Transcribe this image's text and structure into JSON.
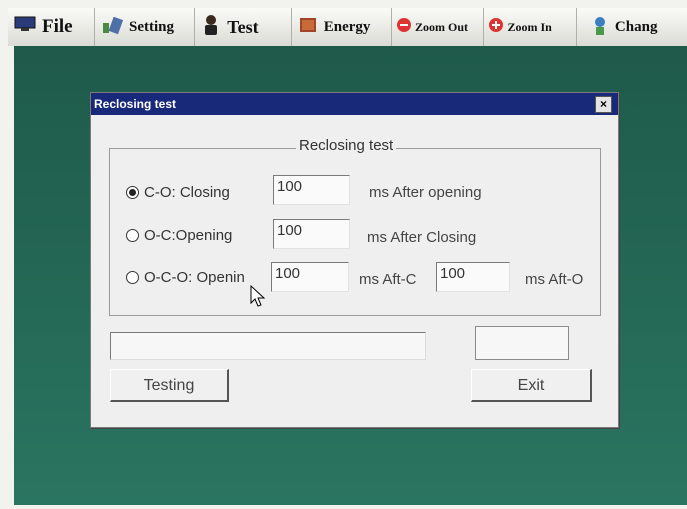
{
  "menubar": {
    "items": [
      {
        "label": "File",
        "icon": "monitor-icon"
      },
      {
        "label": "Setting",
        "icon": "setting-icon"
      },
      {
        "label": "Test",
        "icon": "person-icon"
      },
      {
        "label": "Energy",
        "icon": "book-icon"
      },
      {
        "label": "Zoom Out",
        "icon": "minus-circle-icon"
      },
      {
        "label": "Zoom In",
        "icon": "plus-circle-icon"
      },
      {
        "label": "Chang",
        "icon": "change-icon"
      }
    ]
  },
  "dialog": {
    "title": "Reclosing test",
    "close": "×",
    "group_label": "Reclosing test",
    "options": [
      {
        "label": "C-O: Closing",
        "checked": true,
        "value": "100",
        "unit": "ms After opening"
      },
      {
        "label": "O-C:Opening",
        "checked": false,
        "value": "100",
        "unit": "ms After Closing"
      },
      {
        "label": "O-C-O: Openin",
        "checked": false,
        "value": "100",
        "unit": "ms Aft-C",
        "value2": "100",
        "unit2": "ms Aft-O"
      }
    ],
    "progress_value": "",
    "status_value": "",
    "testing_button": "Testing",
    "exit_button": "Exit"
  },
  "colors": {
    "titlebar": "#19297a",
    "desktop": "#236653",
    "dialog_bg": "#efefef"
  }
}
